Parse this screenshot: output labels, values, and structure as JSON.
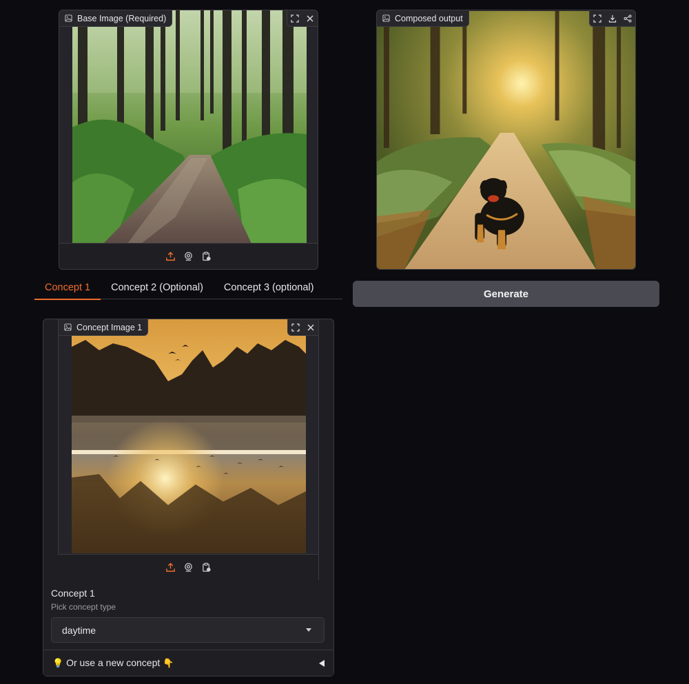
{
  "base_panel": {
    "label": "Base Image (Required)",
    "label_icon": "image-icon",
    "tools": [
      "fullscreen-icon",
      "close-icon"
    ],
    "sources": [
      "upload-icon",
      "webcam-icon",
      "clipboard-icon"
    ]
  },
  "output_panel": {
    "label": "Composed output",
    "label_icon": "image-icon",
    "tools": [
      "fullscreen-icon",
      "download-icon",
      "share-icon"
    ]
  },
  "tabs": [
    {
      "label": "Concept 1",
      "active": true
    },
    {
      "label": "Concept 2 (Optional)",
      "active": false
    },
    {
      "label": "Concept 3 (optional)",
      "active": false
    }
  ],
  "generate_button": {
    "label": "Generate"
  },
  "concept_panel": {
    "label": "Concept Image 1",
    "label_icon": "image-icon",
    "tools": [
      "fullscreen-icon",
      "close-icon"
    ],
    "sources": [
      "upload-icon",
      "webcam-icon",
      "clipboard-icon"
    ]
  },
  "concept_form": {
    "title": "Concept 1",
    "subtitle": "Pick concept type",
    "selected": "daytime"
  },
  "accordion": {
    "lead_emoji": "💡",
    "label": "Or use a new concept",
    "trail_emoji": "👇"
  },
  "colors": {
    "accent": "#f06c2b",
    "background": "#0c0c10",
    "panel": "#1f1f23",
    "button": "#4a4a52"
  }
}
